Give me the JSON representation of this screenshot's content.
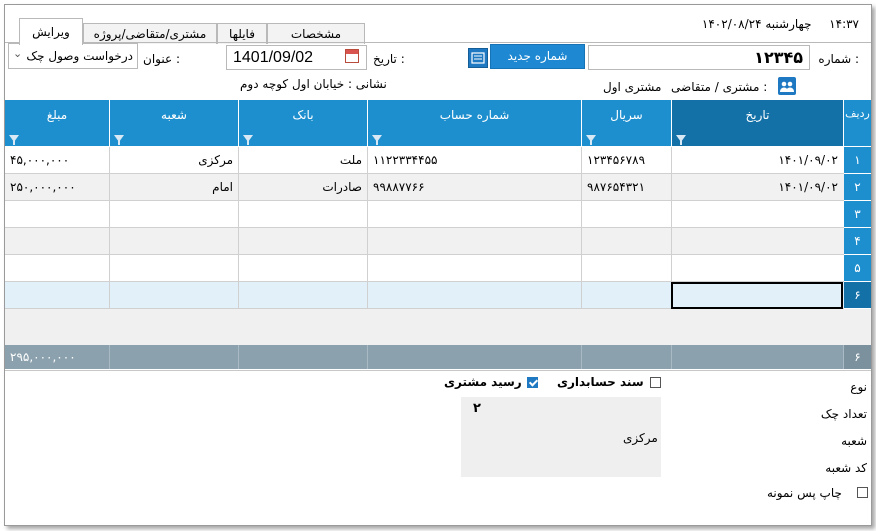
{
  "window": {
    "clock": "۱۴:۳۷",
    "date_text": "چهارشنبه ۱۴۰۲/۰۸/۲۴"
  },
  "tabs": [
    {
      "label": "مشخصات"
    },
    {
      "label": "فایلها"
    },
    {
      "label": "مشتری/متقاضی/پروژه"
    },
    {
      "label": "ویرایش"
    }
  ],
  "form": {
    "number_label": "شماره :",
    "number_value": "۱۲۳۴۵",
    "new_number_button": "شماره جدید",
    "date_label": "تاریخ :",
    "date_value": "1401/09/02",
    "title_label": "عنوان :",
    "title_value": "درخواست وصول چک",
    "customer_label": "مشتری / متقاضی :",
    "customer_value": "مشتری اول",
    "address_text": "نشانی : خیابان اول کوچه دوم"
  },
  "grid": {
    "columns": [
      {
        "key": "row",
        "label": "ردیف"
      },
      {
        "key": "date",
        "label": "تاریخ"
      },
      {
        "key": "serial",
        "label": "سریال"
      },
      {
        "key": "account",
        "label": "شماره حساب"
      },
      {
        "key": "bank",
        "label": "بانک"
      },
      {
        "key": "branch",
        "label": "شعبه"
      },
      {
        "key": "amount",
        "label": "مبلغ"
      }
    ],
    "rows": [
      {
        "n": "۱",
        "date": "۱۴۰۱/۰۹/۰۲",
        "serial": "۱۲۳۴۵۶۷۸۹",
        "account": "۱۱۲۲۳۳۴۴۵۵",
        "bank": "ملت",
        "branch": "مرکزی",
        "amount": "۴۵,۰۰۰,۰۰۰"
      },
      {
        "n": "۲",
        "date": "۱۴۰۱/۰۹/۰۲",
        "serial": "۹۸۷۶۵۴۳۲۱",
        "account": "۹۹۸۸۷۷۶۶",
        "bank": "صادرات",
        "branch": "امام",
        "amount": "۲۵۰,۰۰۰,۰۰۰"
      },
      {
        "n": "۳",
        "date": "",
        "serial": "",
        "account": "",
        "bank": "",
        "branch": "",
        "amount": ""
      },
      {
        "n": "۴",
        "date": "",
        "serial": "",
        "account": "",
        "bank": "",
        "branch": "",
        "amount": ""
      },
      {
        "n": "۵",
        "date": "",
        "serial": "",
        "account": "",
        "bank": "",
        "branch": "",
        "amount": ""
      },
      {
        "n": "۶",
        "date": "",
        "serial": "",
        "account": "",
        "bank": "",
        "branch": "",
        "amount": ""
      }
    ],
    "footer_count": "۶",
    "footer_total": "۲۹۵,۰۰۰,۰۰۰"
  },
  "details": {
    "type_label": "نوع",
    "accounting_doc_label": "سند حسابداری",
    "accounting_doc_checked": false,
    "customer_receipt_label": "رسید مشتری",
    "customer_receipt_checked": true,
    "check_count_label": "تعداد چک",
    "check_count_value": "۲",
    "branch_label": "شعبه",
    "branch_value": "مرکزی",
    "branch_code_label": "کد شعبه",
    "print_after_save_label": "چاپ پس نمونه",
    "print_after_save_checked": false
  }
}
